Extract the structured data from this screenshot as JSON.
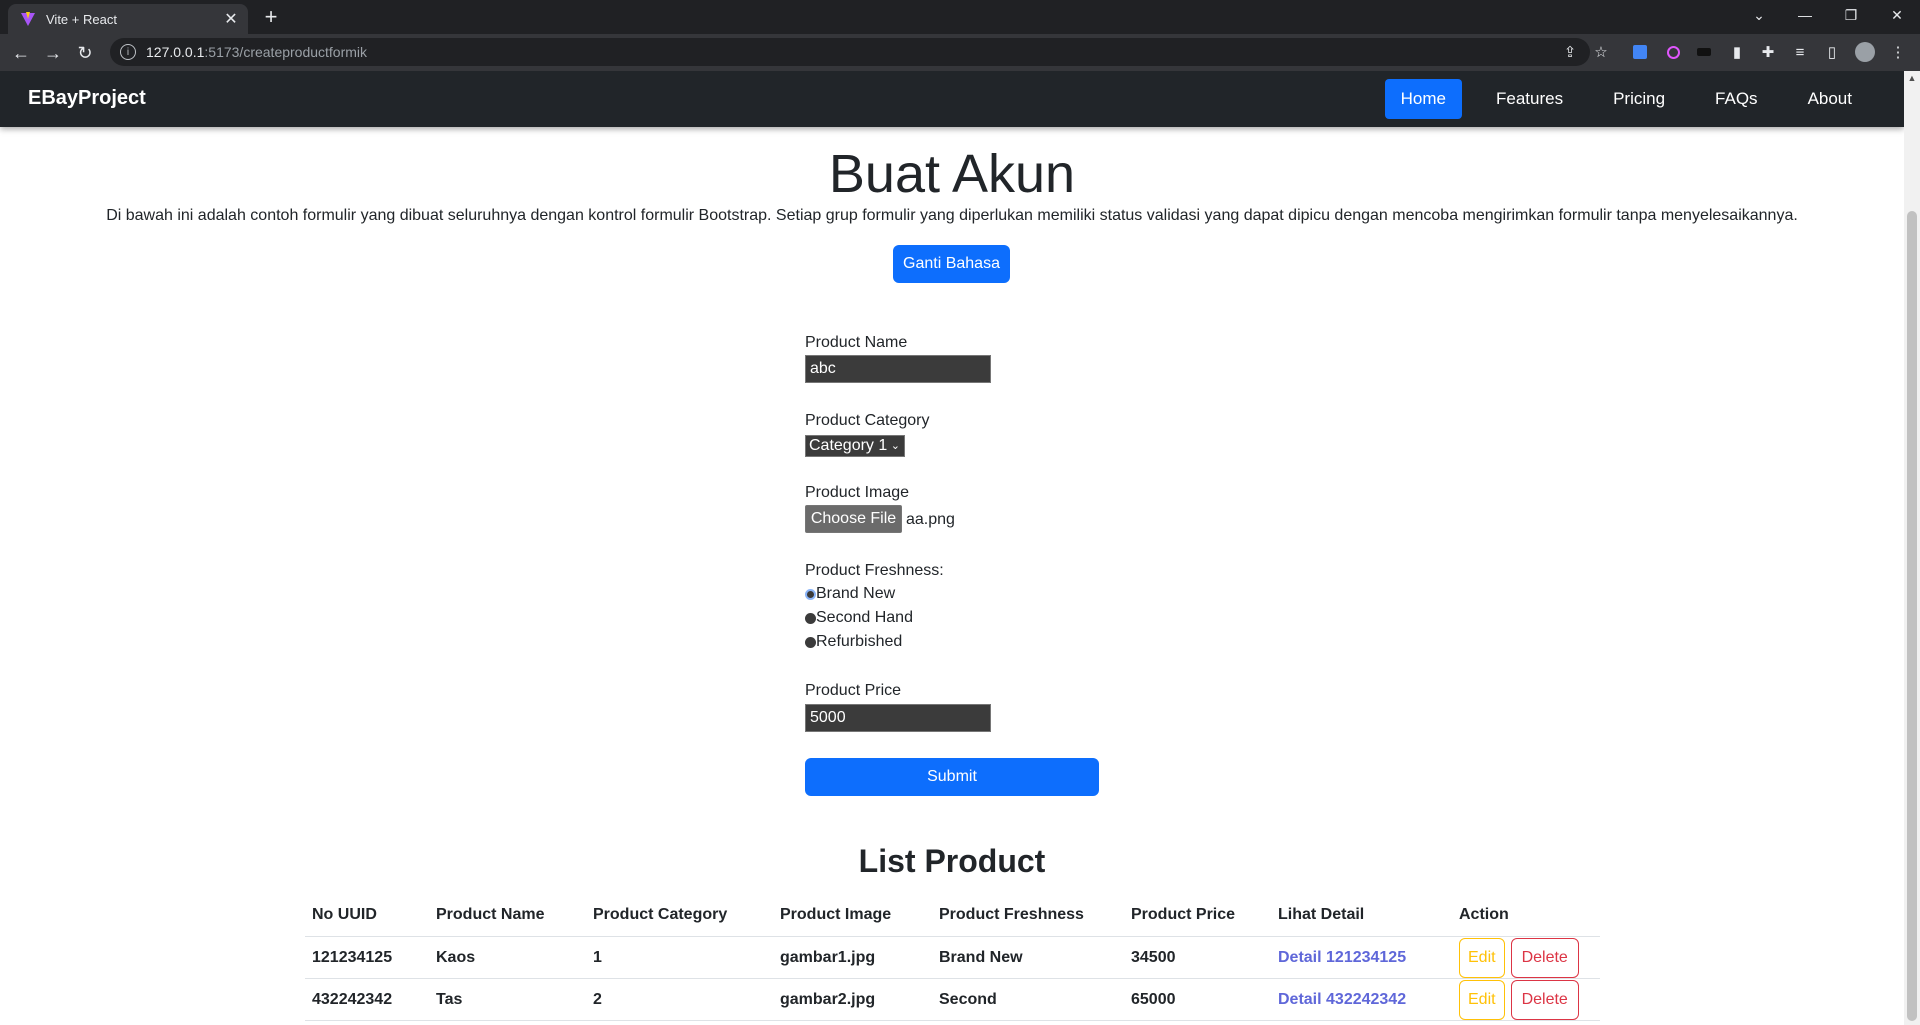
{
  "browser": {
    "tab_title": "Vite + React",
    "tab_close": "✕",
    "new_tab": "+",
    "url_host": "127.0.0.1",
    "url_path": ":5173/createproductformik"
  },
  "navbar": {
    "brand": "EBayProject",
    "links": [
      {
        "label": "Home",
        "active": true
      },
      {
        "label": "Features",
        "active": false
      },
      {
        "label": "Pricing",
        "active": false
      },
      {
        "label": "FAQs",
        "active": false
      },
      {
        "label": "About",
        "active": false
      }
    ]
  },
  "header": {
    "title": "Buat Akun",
    "description": "Di bawah ini adalah contoh formulir yang dibuat seluruhnya dengan kontrol formulir Bootstrap. Setiap grup formulir yang diperlukan memiliki status validasi yang dapat dipicu dengan mencoba mengirimkan formulir tanpa menyelesaikannya.",
    "language_button": "Ganti Bahasa"
  },
  "form": {
    "product_name_label": "Product Name",
    "product_name_value": "abc",
    "product_category_label": "Product Category",
    "product_category_value": "Category 1",
    "product_image_label": "Product Image",
    "choose_file_label": "Choose File",
    "file_name": "aa.png",
    "freshness_label": "Product Freshness:",
    "freshness_options": [
      {
        "label": "Brand New",
        "checked": true
      },
      {
        "label": "Second Hand",
        "checked": false
      },
      {
        "label": "Refurbished",
        "checked": false
      }
    ],
    "product_price_label": "Product Price",
    "product_price_value": "5000",
    "submit_label": "Submit"
  },
  "list": {
    "title": "List Product",
    "columns": [
      "No UUID",
      "Product Name",
      "Product Category",
      "Product Image",
      "Product Freshness",
      "Product Price",
      "Lihat Detail",
      "Action"
    ],
    "rows": [
      {
        "uuid": "121234125",
        "name": "Kaos",
        "category": "1",
        "image": "gambar1.jpg",
        "freshness": "Brand New",
        "price": "34500",
        "detail": "Detail 121234125",
        "edit": "Edit",
        "delete": "Delete"
      },
      {
        "uuid": "432242342",
        "name": "Tas",
        "category": "2",
        "image": "gambar2.jpg",
        "freshness": "Second",
        "price": "65000",
        "detail": "Detail 432242342",
        "edit": "Edit",
        "delete": "Delete"
      }
    ]
  },
  "colors": {
    "primary": "#0d6efd",
    "navbar_bg": "#212529",
    "edit": "#ffc107",
    "delete": "#dc3545",
    "link": "#5f67d9"
  }
}
